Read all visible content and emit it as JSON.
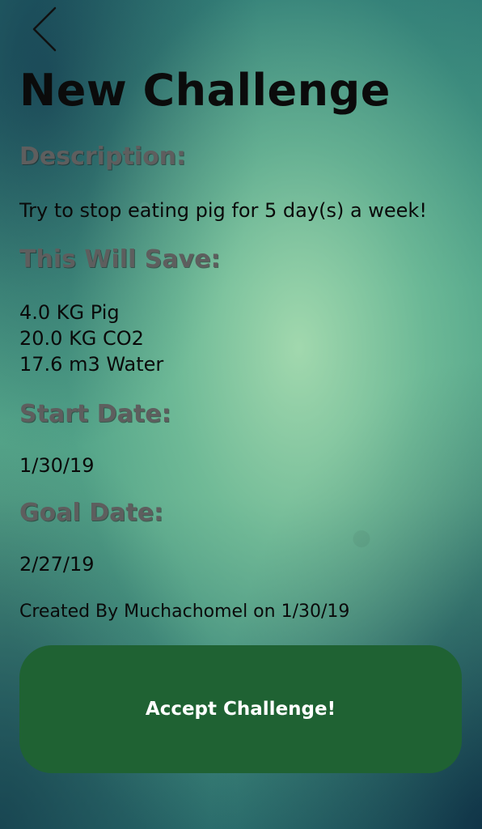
{
  "header": {
    "back_icon": "chevron-left-icon",
    "title": "New Challenge"
  },
  "description": {
    "label": "Description:",
    "text": "Try to stop eating pig for 5 day(s) a week!"
  },
  "savings": {
    "label": "This Will Save:",
    "items": [
      "4.0 KG Pig",
      "20.0 KG CO2",
      "17.6 m3 Water"
    ]
  },
  "start": {
    "label": "Start Date:",
    "value": "1/30/19"
  },
  "goal": {
    "label": "Goal Date:",
    "value": "2/27/19"
  },
  "created_by": "Created By Muchachomel on 1/30/19",
  "accept_button": {
    "label": "Accept Challenge!",
    "color": "#1f6233"
  }
}
